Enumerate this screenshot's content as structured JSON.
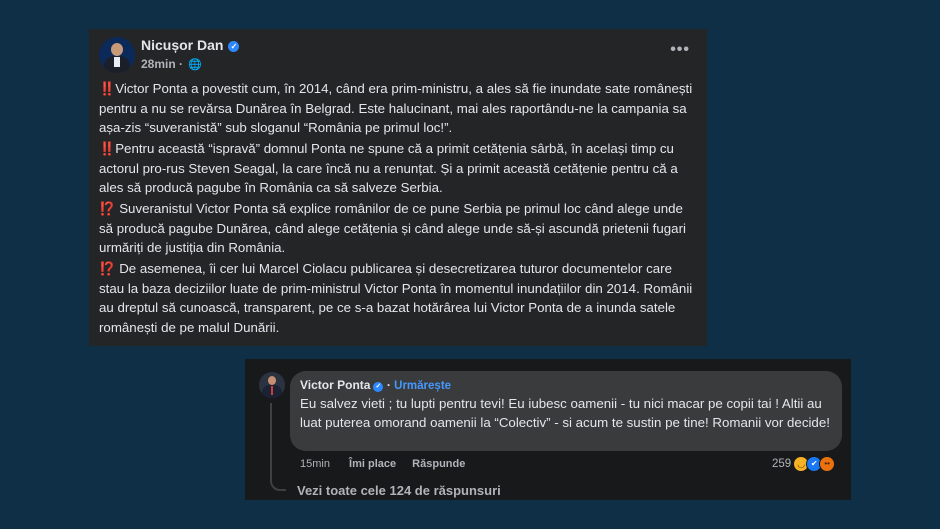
{
  "post": {
    "author": "Nicușor Dan",
    "time": "28min",
    "paragraphs": [
      {
        "emoji": "‼️",
        "text": "Victor Ponta a povestit cum, în 2014, când era prim-ministru, a ales să fie inundate sate românești pentru a nu se revărsa Dunărea în Belgrad. Este halucinant, mai ales raportându-ne la campania sa așa-zis “suveranistă” sub sloganul “România pe primul loc!”."
      },
      {
        "emoji": "‼️",
        "text": "Pentru această “ispravă” domnul Ponta ne spune că a primit cetățenia sârbă, în același timp cu actorul pro-rus Steven Seagal, la care încă nu a renunțat. Și a primit această cetățenie pentru că a ales să producă pagube în România ca să salveze Serbia."
      },
      {
        "emoji": "⁉️",
        "text": "Suveranistul Victor Ponta să explice românilor de ce pune Serbia pe primul loc când alege unde să producă pagube Dunărea, când alege cetățenia și când alege unde să-și ascundă prietenii fugari urmăriți de justiția din România."
      },
      {
        "emoji": "⁉️",
        "text": "De asemenea, îi cer lui Marcel Ciolacu publicarea și desecretizarea tuturor documentelor care stau la baza deciziilor luate de prim-ministrul Victor Ponta în momentul inundațiilor din 2014. Românii au dreptul să cunoască, transparent, pe ce s-a bazat hotărârea lui Victor Ponta de a inunda satele românești de pe malul Dunării."
      }
    ]
  },
  "comment": {
    "author": "Victor Ponta",
    "separator": "·",
    "follow_label": "Urmărește",
    "text": "Eu salvez vieti ; tu lupti pentru tevi! Eu iubesc oamenii - tu nici macar pe copii tai ! Altii au luat puterea omorand oamenii la “Colectiv” - si acum te sustin pe tine! Romanii vor decide!",
    "time": "15min",
    "like_label": "Îmi place",
    "reply_label": "Răspunde",
    "reaction_count": "259",
    "reactions": [
      "haha",
      "like",
      "angry"
    ],
    "view_replies": "Vezi toate cele 124 de răspunsuri"
  },
  "icons": {
    "more": "more-options-icon",
    "globe": "globe-icon",
    "verified": "verified-badge-icon"
  },
  "colors": {
    "background": "#0e2f45",
    "post_bg": "#242526",
    "bubble_bg": "#3a3b3c",
    "accent": "#2d88ff"
  }
}
